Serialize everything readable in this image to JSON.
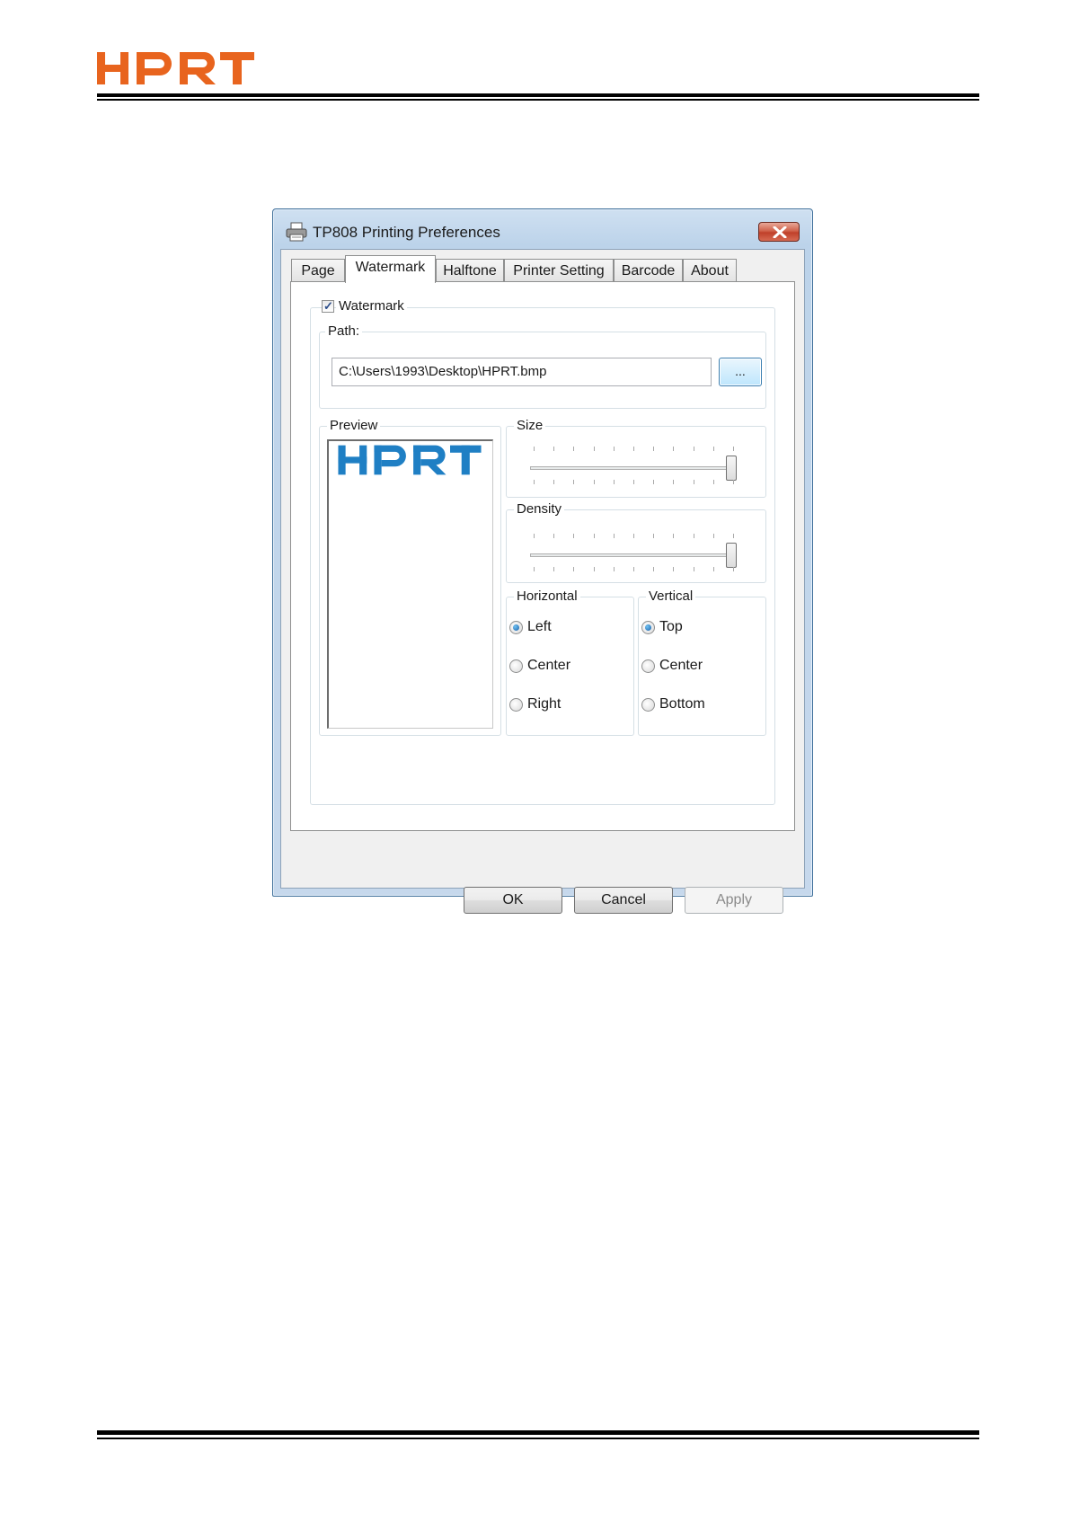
{
  "page": {
    "brand": "HPRT",
    "brand_color": "#e8641e"
  },
  "dialog": {
    "title": "TP808 Printing Preferences",
    "title_icon": "printer-icon",
    "close_icon": "close-icon",
    "tabs": [
      {
        "label": "Page",
        "active": false
      },
      {
        "label": "Watermark",
        "active": true
      },
      {
        "label": "Halftone",
        "active": false
      },
      {
        "label": "Printer Setting",
        "active": false
      },
      {
        "label": "Barcode",
        "active": false
      },
      {
        "label": "About",
        "active": false
      }
    ],
    "watermark": {
      "checkbox_label": "Watermark",
      "checked": true,
      "path_label": "Path:",
      "path_value": "C:\\Users\\1993\\Desktop\\HPRT.bmp",
      "browse_label": "...",
      "preview_label": "Preview",
      "preview_image_text": "HPRT",
      "preview_color": "#1f7fc4",
      "size_label": "Size",
      "size_level": 1.0,
      "density_label": "Density",
      "density_level": 1.0,
      "horizontal": {
        "label": "Horizontal",
        "options": [
          "Left",
          "Center",
          "Right"
        ],
        "selected": "Left"
      },
      "vertical": {
        "label": "Vertical",
        "options": [
          "Top",
          "Center",
          "Bottom"
        ],
        "selected": "Top"
      }
    },
    "buttons": {
      "ok": "OK",
      "cancel": "Cancel",
      "apply": "Apply"
    }
  }
}
